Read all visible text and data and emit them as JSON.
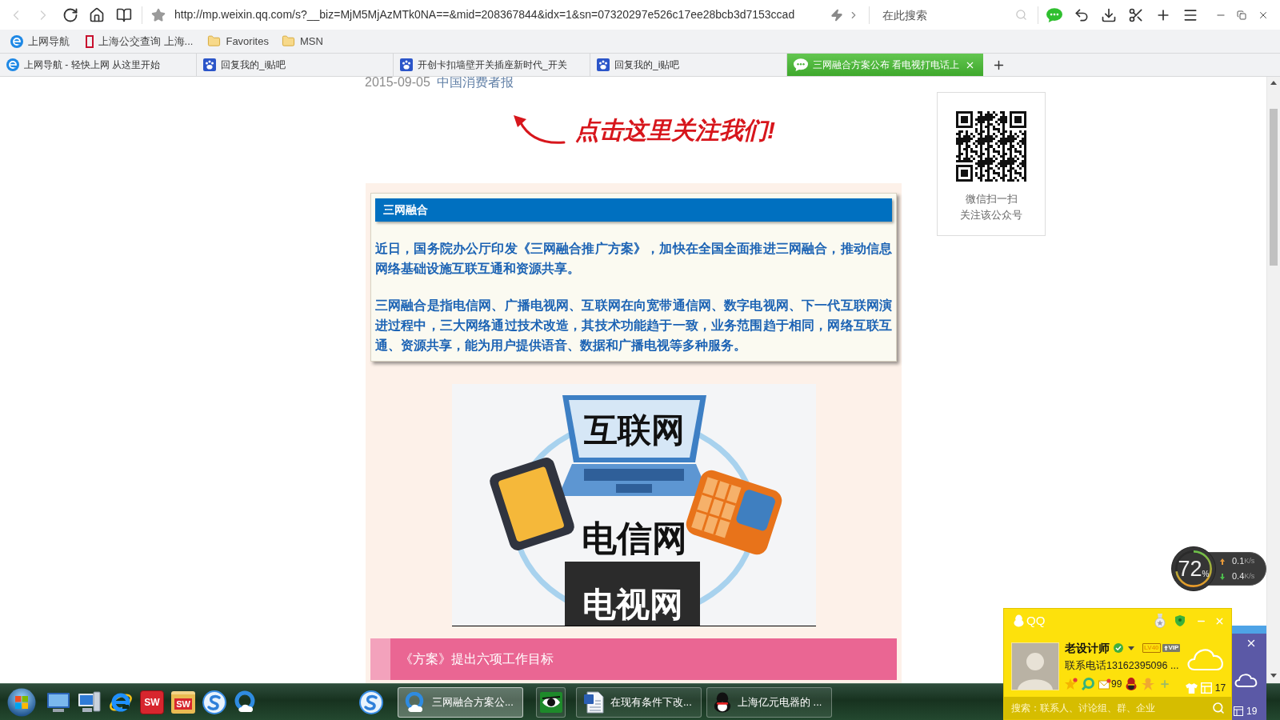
{
  "browser": {
    "nav": {
      "url": "http://mp.weixin.qq.com/s?__biz=MjM5MjAzMTk0NA==&mid=208367844&idx=1&sn=07320297e526c17ee28bcb3d7153ccad",
      "search": {
        "placeholder": "在此搜索"
      }
    },
    "bookmarks": [
      {
        "kind": "site",
        "label": "上网导航"
      },
      {
        "kind": "page",
        "label": "上海公交查询 上海..."
      },
      {
        "kind": "folder",
        "label": "Favorites"
      },
      {
        "kind": "folder",
        "label": "MSN"
      }
    ],
    "tabs": [
      {
        "kind": "site",
        "title": "上网导航 - 轻快上网 从这里开始",
        "selected": false
      },
      {
        "kind": "forum",
        "title": "回复我的_i贴吧",
        "selected": false
      },
      {
        "kind": "forum",
        "title": "开创卡扣墙壁开关插座新时代_开关",
        "selected": false
      },
      {
        "kind": "forum",
        "title": "回复我的_i贴吧",
        "selected": false
      },
      {
        "kind": "chat",
        "title": "三网融合方案公布 看电视打电话上",
        "selected": true
      }
    ]
  },
  "article": {
    "date": "2015-09-05",
    "source": "中国消费者报",
    "follow_banner": "点击这里关注我们!",
    "summary": {
      "heading": "三网融合",
      "paragraphs": [
        "近日，国务院办公厅印发《三网融合推广方案》，加快在全国全面推进三网融合，推动信息网络基础设施互联互通和资源共享。",
        "三网融合是指电信网、广播电视网、互联网在向宽带通信网、数字电视网、下一代互联网演进过程中，三大网络通过技术改造，其技术功能趋于一致，业务范围趋于相同，网络互联互通、资源共享，能为用户提供语音、数据和广播电视等多种服务。"
      ]
    },
    "illustration": {
      "labels": [
        "互联网",
        "电信网",
        "电视网"
      ]
    },
    "subheading": "《方案》提出六项工作目标"
  },
  "qr_panel": {
    "caption": [
      "微信扫一扫",
      "关注该公众号"
    ]
  },
  "speed_meter": {
    "level": 0.72,
    "percent": "72",
    "percent_sign": "%",
    "rates": [
      {
        "kind": "upload",
        "value": "0.1",
        "unit": "K/s"
      },
      {
        "kind": "download",
        "value": "0.4",
        "unit": "K/s"
      }
    ]
  },
  "qq_panel": {
    "title": "QQ",
    "nickname": "老设计师",
    "level_badge": "LV40",
    "vip_badge": "VIP",
    "signature": "联系电话13162395096 ...",
    "mail_count": "99",
    "skin_count": "17",
    "search": {
      "placeholder": "搜索：联系人、讨论组、群、企业"
    }
  },
  "side_panel": {
    "count": "19"
  },
  "taskbar": {
    "quick_launch": [
      {
        "kind": "desktop"
      },
      {
        "kind": "computer"
      },
      {
        "kind": "ie"
      },
      {
        "kind": "sw",
        "logo": "SW"
      },
      {
        "kind": "sw_folder",
        "logo": "SW"
      },
      {
        "kind": "sogou"
      },
      {
        "kind": "cloud"
      }
    ],
    "pinned": [
      {
        "kind": "sogou"
      }
    ],
    "tasks": [
      {
        "kind": "browser",
        "label": "三网融合方案公...",
        "selected": true
      },
      {
        "kind": "viewer",
        "selected": false
      },
      {
        "kind": "document",
        "label": "在现有条件下改...",
        "selected": false
      },
      {
        "kind": "chat",
        "label": "上海亿元电器的 ...",
        "selected": false
      }
    ]
  }
}
